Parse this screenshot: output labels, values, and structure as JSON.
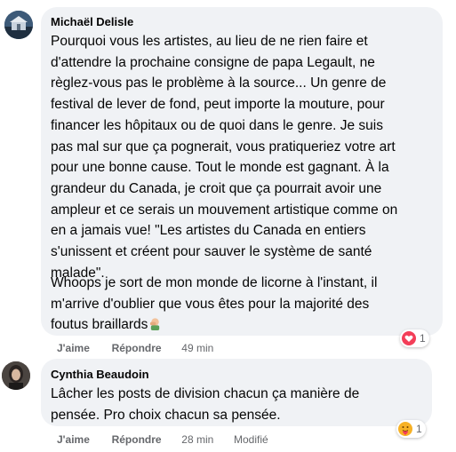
{
  "comments": [
    {
      "author": "Michaël Delisle",
      "paragraph1": "Pourquoi vous les artistes, au lieu de ne rien faire et\nd'attendre la prochaine consigne de papa Legault, ne\nrèglez-vous pas le problème à la source... Un genre de\nfestival de lever de fond, peut importe la mouture, pour\nfinancer les hôpitaux ou de quoi dans le genre. Je suis\npas mal sur que ça pognerait, vous pratiqueriez votre art\npour une bonne cause. Tout le monde est gagnant. À la\ngrandeur du Canada, je croit que ça pourrait avoir une\nampleur et ce serais un mouvement artistique comme on\nen a jamais vue! \"Les artistes du Canada en entiers\ns'unissent et créent pour sauver le système de santé\nmalade\".",
      "paragraph2": "Whoops je sort de mon monde de licorne à l'instant, il\nm'arrive d'oublier que vous êtes pour la majorité des\nfoutus braillards",
      "paragraph2_emoji": "facepalm-emoji",
      "like_label": "J'aime",
      "reply_label": "Répondre",
      "time": "49 min",
      "reaction": {
        "icon": "heart-icon",
        "count": "1",
        "color": "#f33e58"
      }
    },
    {
      "author": "Cynthia Beaudoin",
      "text": "Lâcher les posts de division chacun ça manière de\npensée. Pro choix chacun sa pensée.",
      "like_label": "J'aime",
      "reply_label": "Répondre",
      "time": "28 min",
      "edited_label": "Modifié",
      "reaction": {
        "icon": "care-icon",
        "count": "1",
        "color": "#f7b125"
      }
    }
  ],
  "colors": {
    "bubble": "#f0f2f5",
    "text": "#050505",
    "secondary": "#65676b"
  }
}
